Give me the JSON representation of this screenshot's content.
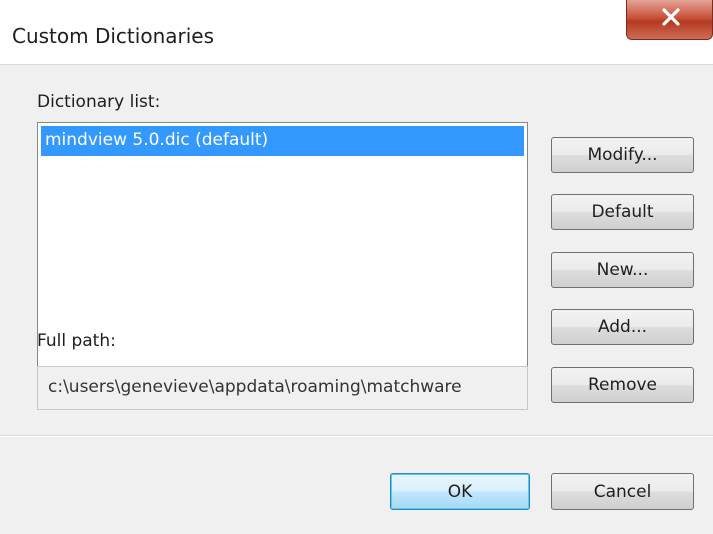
{
  "window": {
    "title": "Custom Dictionaries"
  },
  "dictionary_list": {
    "label": "Dictionary list:",
    "items": [
      {
        "label": "mindview 5.0.dic (default)",
        "selected": true
      }
    ]
  },
  "full_path": {
    "label": "Full path:",
    "value": "c:\\users\\genevieve\\appdata\\roaming\\matchware"
  },
  "buttons": {
    "modify": "Modify...",
    "default": "Default",
    "new": "New...",
    "add": "Add...",
    "remove": "Remove",
    "ok": "OK",
    "cancel": "Cancel"
  },
  "colors": {
    "selection": "#3399ff",
    "close_button": "#c9533c",
    "dialog_background": "#f0f0f0"
  },
  "icons": {
    "close": "close-icon"
  }
}
